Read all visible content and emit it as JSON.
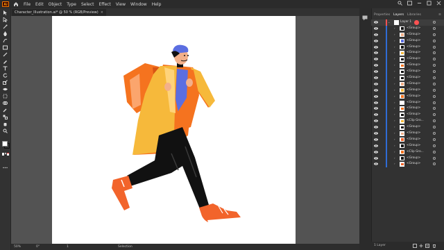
{
  "app": {
    "logo_text": "Ai",
    "accent": "#ff7c00"
  },
  "menu": [
    "File",
    "Edit",
    "Object",
    "Type",
    "Select",
    "Effect",
    "View",
    "Window",
    "Help"
  ],
  "document": {
    "tab_title": "Character_Illustration.ai* @ 50 % (RGB/Preview)",
    "close": "×"
  },
  "status_bar": {
    "zoom": "50%",
    "angle": "0°",
    "artboard": "1",
    "tool": "Selection"
  },
  "panel": {
    "tabs": [
      "Properties",
      "Layers",
      "Libraries"
    ],
    "active_tab": "Layers",
    "layer_name": "Layer 1",
    "items": [
      "<Group>",
      "<Group>",
      "<Group>",
      "<Group>",
      "<Group>",
      "<Group>",
      "<Group>",
      "<Group>",
      "<Group>",
      "<Group>",
      "<Group>",
      "<Group>",
      "<Group>",
      "<Group>",
      "<Group>",
      "<Clip Gro...",
      "<Group>",
      "<Group>",
      "<Group>",
      "<Group>",
      "<Clip Gro...",
      "<Group>",
      "<Group>"
    ],
    "footer": "1 Layer"
  },
  "colors": {
    "coat": "#f6b93b",
    "coat_shadow": "#f5731f",
    "pants": "#111111",
    "shirt": "#5b6ee1",
    "shoes": "#f2642b",
    "selection": "#2f6cd5",
    "layer_color": "#ff5252"
  }
}
